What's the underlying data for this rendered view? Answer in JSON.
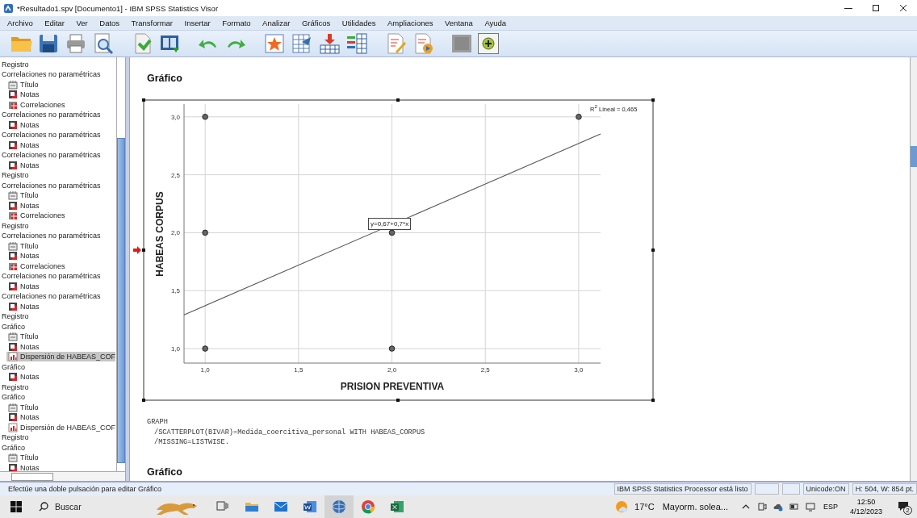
{
  "window": {
    "title": "*Resultado1.spv [Documento1] - IBM SPSS Statistics Visor"
  },
  "menu": [
    "Archivo",
    "Editar",
    "Ver",
    "Datos",
    "Transformar",
    "Insertar",
    "Formato",
    "Analizar",
    "Gráficos",
    "Utilidades",
    "Ampliaciones",
    "Ventana",
    "Ayuda"
  ],
  "navigator": {
    "items": [
      {
        "label": "Registro",
        "selected": false
      },
      {
        "label": "Correlaciones no paramétricas",
        "selected": false,
        "children": [
          {
            "label": "Título",
            "kind": "title",
            "selected": false
          },
          {
            "label": "Notas",
            "kind": "notes",
            "selected": false
          },
          {
            "label": "Correlaciones",
            "kind": "table",
            "selected": false
          }
        ]
      },
      {
        "label": "Correlaciones no paramétricas",
        "selected": false,
        "children": [
          {
            "label": "Notas",
            "kind": "notes",
            "selected": false
          }
        ]
      },
      {
        "label": "Correlaciones no paramétricas",
        "selected": false,
        "children": [
          {
            "label": "Notas",
            "kind": "notes",
            "selected": false
          }
        ]
      },
      {
        "label": "Correlaciones no paramétricas",
        "selected": false,
        "children": [
          {
            "label": "Notas",
            "kind": "notes",
            "selected": false
          }
        ]
      },
      {
        "label": "Registro",
        "selected": false
      },
      {
        "label": "Correlaciones no paramétricas",
        "selected": false,
        "children": [
          {
            "label": "Título",
            "kind": "title",
            "selected": false
          },
          {
            "label": "Notas",
            "kind": "notes",
            "selected": false
          },
          {
            "label": "Correlaciones",
            "kind": "table",
            "selected": false
          }
        ]
      },
      {
        "label": "Registro",
        "selected": false
      },
      {
        "label": "Correlaciones no paramétricas",
        "selected": false,
        "children": [
          {
            "label": "Título",
            "kind": "title",
            "selected": false
          },
          {
            "label": "Notas",
            "kind": "notes",
            "selected": false
          },
          {
            "label": "Correlaciones",
            "kind": "table",
            "selected": false
          }
        ]
      },
      {
        "label": "Correlaciones no paramétricas",
        "selected": false,
        "children": [
          {
            "label": "Notas",
            "kind": "notes",
            "selected": false
          }
        ]
      },
      {
        "label": "Correlaciones no paramétricas",
        "selected": false,
        "children": [
          {
            "label": "Notas",
            "kind": "notes",
            "selected": false
          }
        ]
      },
      {
        "label": "Registro",
        "selected": false
      },
      {
        "label": "Gráfico",
        "selected": false,
        "children": [
          {
            "label": "Título",
            "kind": "title",
            "selected": false
          },
          {
            "label": "Notas",
            "kind": "notes",
            "selected": false
          },
          {
            "label": "Dispersión de HABEAS_COF",
            "kind": "chart",
            "selected": true
          }
        ]
      },
      {
        "label": "Gráfico",
        "selected": false,
        "children": [
          {
            "label": "Notas",
            "kind": "notes",
            "selected": false
          }
        ]
      },
      {
        "label": "Registro",
        "selected": false
      },
      {
        "label": "Gráfico",
        "selected": false,
        "children": [
          {
            "label": "Título",
            "kind": "title",
            "selected": false
          },
          {
            "label": "Notas",
            "kind": "notes",
            "selected": false
          },
          {
            "label": "Dispersión de HABEAS_COF",
            "kind": "chart",
            "selected": false
          }
        ]
      },
      {
        "label": "Registro",
        "selected": false
      },
      {
        "label": "Gráfico",
        "selected": false,
        "children": [
          {
            "label": "Título",
            "kind": "title",
            "selected": false
          },
          {
            "label": "Notas",
            "kind": "notes",
            "selected": false
          }
        ]
      }
    ]
  },
  "output": {
    "heading": "Gráfico",
    "chart": {
      "chart_data": {
        "type": "scatter",
        "grid": true,
        "xlabel": "PRISION PREVENTIVA",
        "ylabel": "HABEAS CORPUS",
        "xlim": [
          0.887,
          3.117
        ],
        "ylim": [
          0.875,
          3.11
        ],
        "xticks": [
          {
            "value": 1,
            "label": "1,0"
          },
          {
            "value": 1.5,
            "label": "1,5"
          },
          {
            "value": 2,
            "label": "2,0"
          },
          {
            "value": 2.5,
            "label": "2,5"
          },
          {
            "value": 3,
            "label": "3,0"
          }
        ],
        "yticks": [
          {
            "value": 1,
            "label": "1,0"
          },
          {
            "value": 1.5,
            "label": "1,5"
          },
          {
            "value": 2,
            "label": "2,0"
          },
          {
            "value": 2.5,
            "label": "2,5"
          },
          {
            "value": 3,
            "label": "3,0"
          }
        ],
        "series": [
          {
            "x": [
              1,
              1,
              1,
              2,
              2,
              3
            ],
            "values": [
              3,
              2,
              1,
              2,
              1,
              3
            ]
          },
          {
            "type": "line",
            "x": [
              0.887,
              3.117
            ],
            "values": [
              1.291,
              2.852
            ]
          }
        ],
        "annotations": [
          "R$^{2}$ Lineal = 0,465",
          "y=0,67+0,7*x"
        ]
      }
    },
    "syntax": [
      {
        "kind": "command",
        "text": "GRAPH"
      },
      {
        "kind": "subcommand",
        "text": "/SCATTERPLOT(BIVAR)=Medida_coercitiva_personal WITH HABEAS_CORPUS"
      },
      {
        "kind": "subcommand",
        "text": "/MISSING=LISTWISE."
      }
    ],
    "next_heading": "Gráfico"
  },
  "status_bar": {
    "message": "Efectúe una doble pulsación para editar Gráfico",
    "processor": "IBM SPSS Statistics Processor está listo",
    "unicode": "Unicode:ON",
    "dimensions": "H: 504, W: 854 pt."
  },
  "taskbar": {
    "search_placeholder": "Buscar",
    "apps": [
      {
        "kind": "taskview",
        "selected": false
      },
      {
        "kind": "files",
        "selected": false
      },
      {
        "kind": "mail",
        "selected": false
      },
      {
        "kind": "word",
        "selected": false
      },
      {
        "kind": "spss",
        "selected": true
      },
      {
        "kind": "chrome",
        "selected": false
      },
      {
        "kind": "excel",
        "selected": false
      }
    ],
    "weather": {
      "temperature": "17°C",
      "summary": "Mayorm. solea..."
    },
    "language": "ESP",
    "time": "12:50",
    "date": "4/12/2023",
    "notifications": "2"
  }
}
